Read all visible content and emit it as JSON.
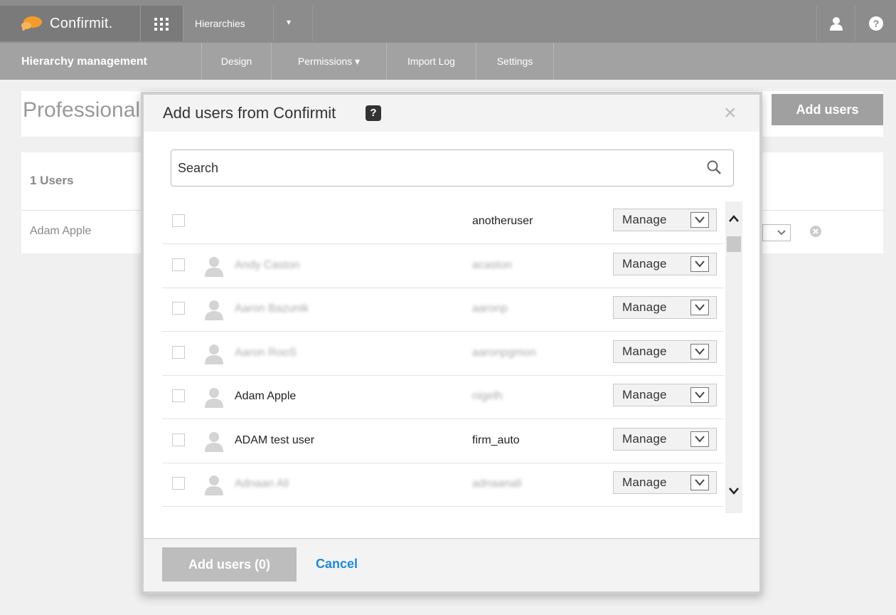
{
  "topbar": {
    "brand": "Confirmit.",
    "app_switcher": "Hierarchies",
    "dropdown_caret": "▾",
    "help_symbol": "?"
  },
  "subnav": {
    "title": "Hierarchy management",
    "items": [
      "Design",
      "Permissions ▾",
      "Import Log",
      "Settings"
    ]
  },
  "page": {
    "title": "Professional",
    "add_users_button": "Add users",
    "users_count": "1 Users",
    "user_row": "Adam Apple"
  },
  "modal": {
    "title": "Add users from Confirmit",
    "help_symbol": "?",
    "close_symbol": "×",
    "search_placeholder": "Search",
    "rows": [
      {
        "name": "",
        "login": "anotheruser",
        "role": "Manage",
        "name_blurred": false,
        "login_blurred": false
      },
      {
        "name": "Andy Caston",
        "login": "acaston",
        "role": "Manage",
        "name_blurred": true,
        "login_blurred": true
      },
      {
        "name": "Aaron Bazunik",
        "login": "aaronp",
        "role": "Manage",
        "name_blurred": true,
        "login_blurred": true
      },
      {
        "name": "Aaron RooS",
        "login": "aaronpgmon",
        "role": "Manage",
        "name_blurred": true,
        "login_blurred": true
      },
      {
        "name": "Adam Apple",
        "login": "nigelh",
        "role": "Manage",
        "name_blurred": false,
        "login_blurred": true
      },
      {
        "name": "ADAM test user",
        "login": "firm_auto",
        "role": "Manage",
        "name_blurred": false,
        "login_blurred": false
      },
      {
        "name": "Adnaan Ali",
        "login": "adnaanali",
        "role": "Manage",
        "name_blurred": true,
        "login_blurred": true
      }
    ],
    "footer": {
      "add_button": "Add users (0)",
      "cancel": "Cancel"
    }
  },
  "colors": {
    "topbar": "#8c8c8c",
    "subnav": "#a2a2a2",
    "link": "#1e8ad6",
    "logo": "#f39c2b"
  }
}
